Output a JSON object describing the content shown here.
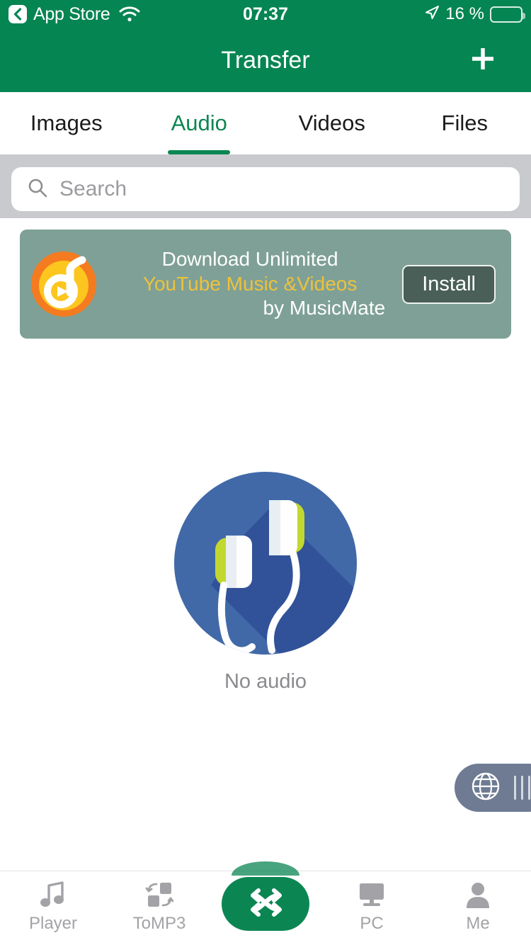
{
  "status_bar": {
    "back_label": "App Store",
    "back_icon": "chevron-left-icon",
    "wifi_icon": "wifi-icon",
    "clock": "07:37",
    "location_icon": "location-arrow-icon",
    "battery_text": "16 %",
    "battery_percent": 16,
    "battery_color": "#f5cb1b"
  },
  "header": {
    "title": "Transfer",
    "add_icon": "plus-icon",
    "background": "#058552"
  },
  "tabs": {
    "items": [
      {
        "label": "Images",
        "active": false
      },
      {
        "label": "Audio",
        "active": true
      },
      {
        "label": "Videos",
        "active": false
      },
      {
        "label": "Files",
        "active": false
      }
    ],
    "accent": "#0b8653"
  },
  "search": {
    "placeholder": "Search",
    "value": "",
    "icon": "search-icon",
    "strip_color": "#c9cace"
  },
  "ad_banner": {
    "logo_icon": "music-note-play-icon",
    "line1": "Download Unlimited",
    "line2": "YouTube Music &Videos",
    "line3": "by MusicMate",
    "button_label": "Install",
    "background": "#7fa096",
    "highlight_color": "#edc23c"
  },
  "empty_state": {
    "illustration": "earbuds-headphones-icon",
    "message": "No audio",
    "circle_color": "#4169a8"
  },
  "float_widget": {
    "icon": "globe-icon",
    "handle": "drag-handle",
    "background": "#6e7b92"
  },
  "bottom_nav": {
    "items": [
      {
        "label": "Player",
        "icon": "music-note-icon"
      },
      {
        "label": "ToMP3",
        "icon": "convert-icon"
      },
      {
        "label": "PC",
        "icon": "desktop-monitor-icon"
      },
      {
        "label": "Me",
        "icon": "person-icon"
      }
    ],
    "center": {
      "icon": "shuffle-transfer-icon",
      "color": "#0b8653"
    },
    "inactive_color": "#a3a3a7"
  }
}
